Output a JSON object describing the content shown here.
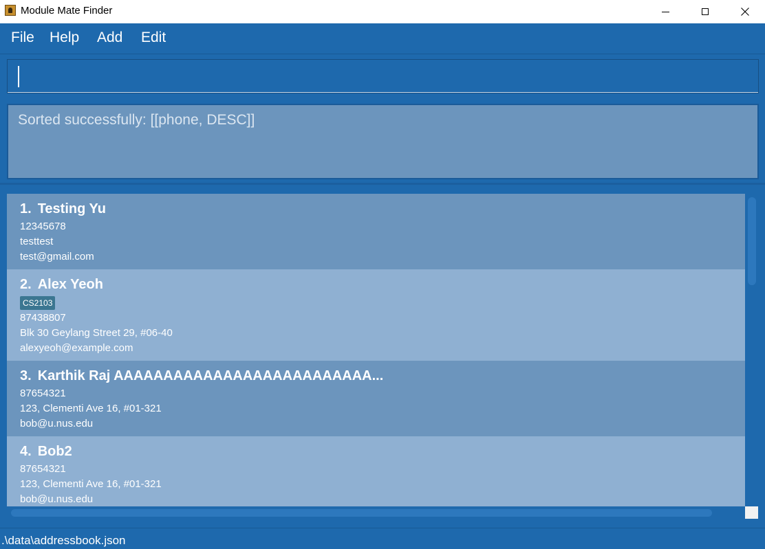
{
  "window": {
    "title": "Module Mate Finder",
    "icon": "app-icon",
    "controls": [
      "minimize-icon",
      "maximize-icon",
      "close-icon"
    ]
  },
  "menu": {
    "file": "File",
    "help": "Help",
    "add": "Add",
    "edit": "Edit"
  },
  "command": {
    "value": "",
    "placeholder": ""
  },
  "result": {
    "message": "Sorted successfully: [[phone, DESC]]"
  },
  "persons": [
    {
      "index": "1.",
      "name": "Testing Yu",
      "tags": [],
      "phone": "12345678",
      "address": "testtest",
      "email": "test@gmail.com"
    },
    {
      "index": "2.",
      "name": "Alex Yeoh",
      "tags": [
        "CS2103"
      ],
      "phone": "87438807",
      "address": "Blk 30 Geylang Street 29, #06-40",
      "email": "alexyeoh@example.com",
      "favourite_icon": "heart-icon"
    },
    {
      "index": "3.",
      "name": "Karthik Raj AAAAAAAAAAAAAAAAAAAAAAAAAA...",
      "tags": [],
      "phone": "87654321",
      "address": "123, Clementi Ave 16, #01-321",
      "email": "bob@u.nus.edu"
    },
    {
      "index": "4.",
      "name": "Bob2",
      "tags": [],
      "phone": "87654321",
      "address": "123, Clementi Ave 16, #01-321",
      "email": "bob@u.nus.edu"
    }
  ],
  "status": {
    "save_path": ".\\data\\addressbook.json"
  },
  "colors": {
    "window_bg": "#1e69ad",
    "card_dark": "#6c95bd",
    "card_light": "#8fb0d2",
    "tag_bg": "#3b7691",
    "heart": "#f44336"
  }
}
